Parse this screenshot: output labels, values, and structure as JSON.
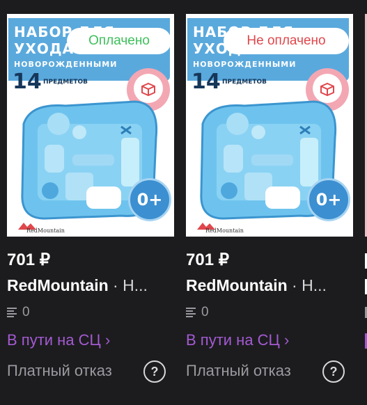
{
  "products": [
    {
      "image_banner": [
        "НАБОР ДЛЯ",
        "УХОДА ЗА",
        "НОВОРОЖДЕННЫМИ"
      ],
      "image_count": "14",
      "image_count_label": "ПРЕДМЕТОВ",
      "image_age": "0+",
      "image_brand": "RedMountain",
      "payment_status": "Оплачено",
      "payment_color": "#3dbf5a",
      "price": "701 ₽",
      "brand": "RedMountain",
      "title_rest": " · Н...",
      "reviews_count": "0",
      "delivery_status": "В пути на СЦ ›",
      "refund_label": "Платный отказ"
    },
    {
      "image_banner": [
        "НАБОР ДЛЯ",
        "УХОДА ЗА",
        "НОВОРОЖДЕННЫМИ"
      ],
      "image_count": "14",
      "image_count_label": "ПРЕДМЕТОВ",
      "image_age": "0+",
      "image_brand": "RedMountain",
      "payment_status": "Не оплачено",
      "payment_color": "#e0474c",
      "price": "701 ₽",
      "brand": "RedMountain",
      "title_rest": " · Н...",
      "reviews_count": "0",
      "delivery_status": "В пути на СЦ ›",
      "refund_label": "Платный отказ"
    }
  ],
  "help_symbol": "?",
  "colors": {
    "background": "#1c1c1e",
    "status_purple": "#a45ad2",
    "muted": "#9a9aa0"
  }
}
